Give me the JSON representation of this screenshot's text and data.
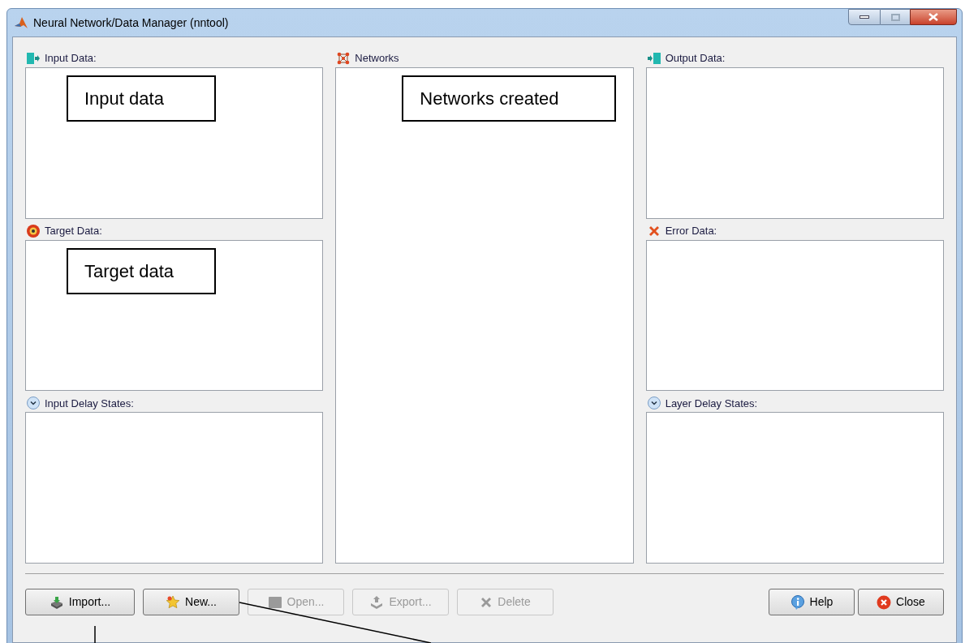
{
  "window": {
    "title": "Neural Network/Data Manager (nntool)"
  },
  "columns": [
    {
      "panels": [
        {
          "label": "Input Data:",
          "kind": "input",
          "callout": "Input data"
        },
        {
          "label": "Target Data:",
          "kind": "target",
          "callout": "Target data"
        },
        {
          "label": "Input Delay States:",
          "kind": "delay"
        }
      ]
    },
    {
      "panels": [
        {
          "label": "Networks",
          "kind": "network",
          "callout": "Networks created"
        }
      ]
    },
    {
      "panels": [
        {
          "label": "Output Data:",
          "kind": "output"
        },
        {
          "label": "Error Data:",
          "kind": "error"
        },
        {
          "label": "Layer Delay States:",
          "kind": "delay"
        }
      ]
    }
  ],
  "buttons_left": [
    {
      "label": "Import...",
      "kind": "import",
      "disabled": false
    },
    {
      "label": "New...",
      "kind": "new",
      "disabled": false
    },
    {
      "label": "Open...",
      "kind": "open",
      "disabled": true
    },
    {
      "label": "Export...",
      "kind": "export",
      "disabled": true
    },
    {
      "label": "Delete",
      "kind": "delete",
      "disabled": true
    }
  ],
  "buttons_right": [
    {
      "label": "Help",
      "kind": "help",
      "disabled": false
    },
    {
      "label": "Close",
      "kind": "close",
      "disabled": false
    }
  ]
}
